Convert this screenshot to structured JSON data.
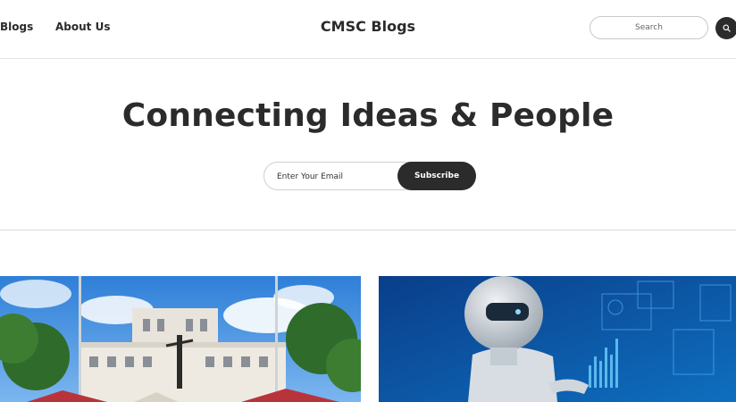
{
  "nav": {
    "links": [
      {
        "label": "Blogs"
      },
      {
        "label": "About Us"
      }
    ],
    "brand": "CMSC Blogs",
    "search": {
      "placeholder": "Search",
      "button_icon": "search-icon"
    }
  },
  "hero": {
    "title": "Connecting Ideas & People",
    "email_placeholder": "Enter Your Email",
    "subscribe_label": "Subscribe"
  },
  "colors": {
    "text": "#2b2b2b",
    "button_bg": "#2b2b2b",
    "button_text": "#ffffff",
    "border": "#d9d9d9"
  },
  "cards": [
    {
      "image": "campus-building-photo"
    },
    {
      "image": "ai-robot-photo"
    }
  ]
}
